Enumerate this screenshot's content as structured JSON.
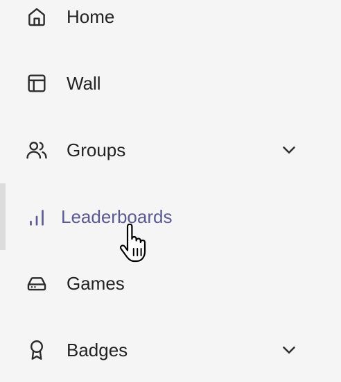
{
  "nav": {
    "items": [
      {
        "label": "Home",
        "icon": "home-icon"
      },
      {
        "label": "Wall",
        "icon": "layout-icon"
      },
      {
        "label": "Groups",
        "icon": "users-icon",
        "expandable": true
      },
      {
        "label": "Leaderboards",
        "icon": "bar-chart-icon",
        "active": true
      },
      {
        "label": "Games",
        "icon": "drive-icon"
      },
      {
        "label": "Badges",
        "icon": "award-icon",
        "expandable": true
      }
    ]
  },
  "colors": {
    "background": "#f5f5f5",
    "text": "#222222",
    "active_text": "#5b5a92",
    "active_indicator": "#dcdcdc"
  }
}
